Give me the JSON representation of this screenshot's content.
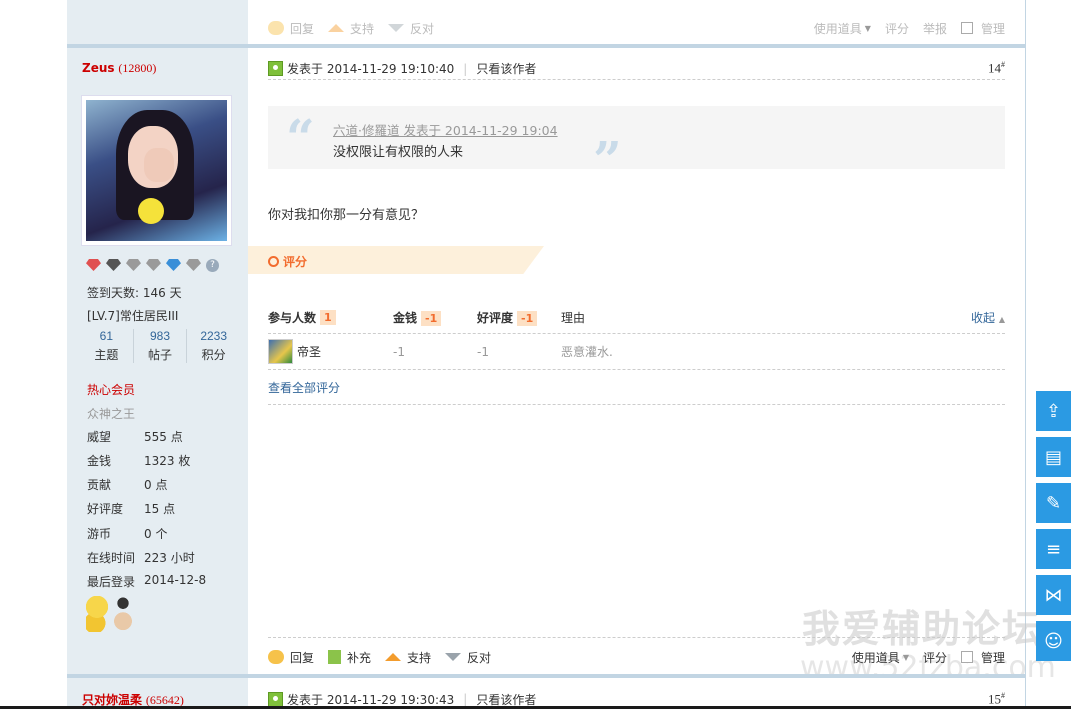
{
  "prev_post_actions": {
    "reply": "回复",
    "support": "支持",
    "oppose": "反对",
    "use_tool": "使用道具",
    "rate": "评分",
    "report": "举报",
    "manage": "管理"
  },
  "author": {
    "name": "Zeus",
    "points_display": "(12800)",
    "signin_days": "签到天数: 146 天",
    "level": "[LV.7]常住居民III",
    "stats": [
      {
        "value": "61",
        "label": "主题"
      },
      {
        "value": "983",
        "label": "帖子"
      },
      {
        "value": "2233",
        "label": "积分"
      }
    ],
    "group": "热心会员",
    "custom_title": "众神之王",
    "props": [
      {
        "k": "威望",
        "v": "555 点"
      },
      {
        "k": "金钱",
        "v": "1323 枚"
      },
      {
        "k": "贡献",
        "v": "0 点"
      },
      {
        "k": "好评度",
        "v": "15 点"
      },
      {
        "k": "游币",
        "v": "0 个"
      },
      {
        "k": "在线时间",
        "v": "223 小时"
      },
      {
        "k": "最后登录",
        "v": "2014-12-8"
      }
    ]
  },
  "post": {
    "posted": "发表于 2014-11-29 19:10:40",
    "only_author": "只看该作者",
    "floor": "14",
    "floor_sup": "#",
    "quote_meta": "六道·修羅道 发表于 2014-11-29 19:04",
    "quote_text": "没权限让有权限的人来",
    "message": "你对我扣你那一分有意见？",
    "rating": {
      "title": "评分",
      "headers": {
        "participants": "参与人数",
        "participants_count": "1",
        "money": "金钱",
        "money_total": "-1",
        "rep": "好评度",
        "rep_total": "-1",
        "reason": "理由",
        "collapse": "收起"
      },
      "rows": [
        {
          "user": "帝圣",
          "money": "-1",
          "rep": "-1",
          "reason": "恶意灌水."
        }
      ],
      "view_all": "查看全部评分"
    },
    "actions": {
      "reply": "回复",
      "supplement": "补充",
      "support": "支持",
      "oppose": "反对",
      "use_tool": "使用道具",
      "rate": "评分",
      "manage": "管理"
    }
  },
  "next_post": {
    "author_name": "只对妳温柔",
    "points_display": "(65642)",
    "posted": "发表于 2014-11-29 19:30:43",
    "only_author": "只看该作者",
    "floor": "15",
    "floor_sup": "#"
  },
  "watermark": {
    "line1": "我爱辅助论坛",
    "line2": "www.52fzba.com"
  },
  "float_tools": [
    {
      "icon": "back-to-top-icon",
      "glyph": "⇪"
    },
    {
      "icon": "document-icon",
      "glyph": "▤"
    },
    {
      "icon": "edit-icon",
      "glyph": "✎"
    },
    {
      "icon": "list-icon",
      "glyph": "≡"
    },
    {
      "icon": "share-icon",
      "glyph": "⋈"
    },
    {
      "icon": "user-icon",
      "glyph": "☺"
    }
  ],
  "colors": {
    "accent_blue": "#2b9ae3",
    "author_red": "#cc0000",
    "rating_orange": "#f26c2e",
    "sidebar_bg": "#e5edf2"
  }
}
